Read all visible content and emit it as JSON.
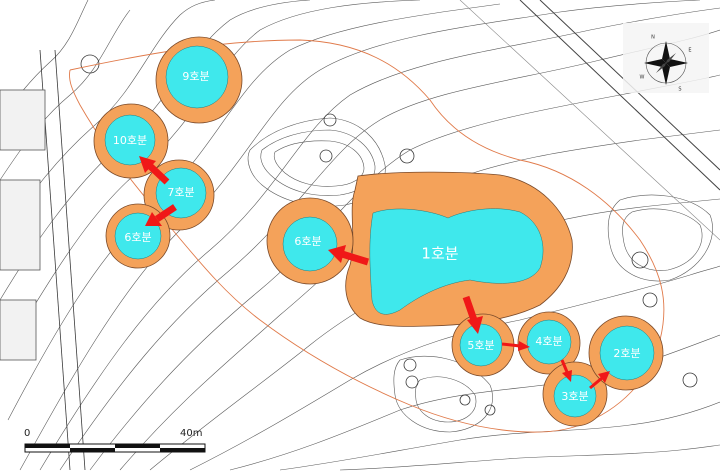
{
  "colors": {
    "background": "#ffffff",
    "contour": "#5a5a5a",
    "survey_line": "#e07a4a",
    "mound_outer": "#f4a25a",
    "mound_outer_stroke": "#7a4a2a",
    "mound_inner": "#3fe8ec",
    "arrow": "#f01818",
    "road": "#cfcfcf"
  },
  "mounds": [
    {
      "id": "m1",
      "label": "1호분"
    },
    {
      "id": "m2",
      "label": "2호분"
    },
    {
      "id": "m3",
      "label": "3호분"
    },
    {
      "id": "m4",
      "label": "4호분"
    },
    {
      "id": "m5",
      "label": "5호분"
    },
    {
      "id": "m6e",
      "label": "6호분"
    },
    {
      "id": "m6w",
      "label": "6호분"
    },
    {
      "id": "m7",
      "label": "7호분"
    },
    {
      "id": "m9",
      "label": "9호분"
    },
    {
      "id": "m10",
      "label": "10호분"
    }
  ],
  "sequence_arrows": [
    {
      "from": "1호분",
      "to": "6호분"
    },
    {
      "from": "1호분",
      "to": "5호분"
    },
    {
      "from": "5호분",
      "to": "4호분"
    },
    {
      "from": "4호분",
      "to": "3호분"
    },
    {
      "from": "3호분",
      "to": "2호분"
    },
    {
      "from": "7호분",
      "to": "10호분"
    },
    {
      "from": "7호분",
      "to": "6호분"
    }
  ],
  "scale_bar": {
    "start_label": "0",
    "end_label": "40m"
  },
  "compass": {
    "letters": [
      "N",
      "E",
      "S",
      "W"
    ],
    "icon": "north-arrow-icon"
  }
}
